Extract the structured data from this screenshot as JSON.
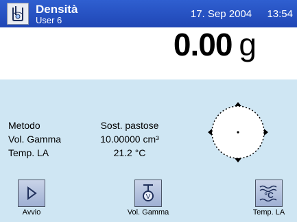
{
  "header": {
    "title": "Densità",
    "user": "User 6",
    "date": "17. Sep 2004",
    "time": "13:54",
    "icon": "beaker-icon"
  },
  "weight": {
    "value": "0.00",
    "unit": "g"
  },
  "info": [
    {
      "label": "Metodo",
      "value": "Sost. pastose"
    },
    {
      "label": "Vol. Gamma",
      "value": "10.00000 cm³"
    },
    {
      "label": "Temp. LA",
      "value": "21.2 °C"
    }
  ],
  "buttons": [
    {
      "label": "Avvio",
      "icon": "play-icon"
    },
    {
      "label": "Vol. Gamma",
      "icon": "gamma-volume-icon"
    },
    {
      "label": "Temp. LA",
      "icon": "temperature-icon"
    }
  ],
  "colors": {
    "header_bg": "#2f5fd0",
    "panel_bg": "#cfe6f3"
  }
}
